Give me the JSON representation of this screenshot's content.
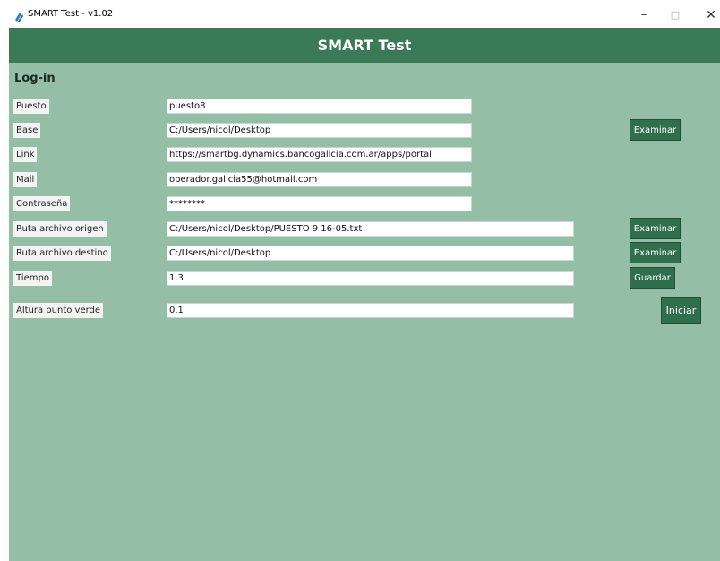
{
  "window": {
    "title": "SMART Test - v1.02",
    "minimize": "–",
    "maximize": "□",
    "close": "✕"
  },
  "header": {
    "title": "SMART Test"
  },
  "section_title": "Log-in",
  "fields": {
    "puesto": {
      "label": "Puesto",
      "value": "puesto8"
    },
    "base": {
      "label": "Base",
      "value": "C:/Users/nicol/Desktop"
    },
    "link": {
      "label": "Link",
      "value": "https://smartbg.dynamics.bancogalicia.com.ar/apps/portal"
    },
    "mail": {
      "label": "Mail",
      "value": "operador.galicia55@hotmail.com"
    },
    "password": {
      "label": "Contraseña",
      "value": "********"
    },
    "origen": {
      "label": "Ruta archivo origen",
      "value": "C:/Users/nicol/Desktop/PUESTO 9 16-05.txt"
    },
    "destino": {
      "label": "Ruta archivo destino",
      "value": "C:/Users/nicol/Desktop"
    },
    "tiempo": {
      "label": "Tiempo",
      "value": "1.3"
    },
    "altura": {
      "label": "Altura punto verde",
      "value": "0.1"
    }
  },
  "buttons": {
    "examinar": "Examinar",
    "guardar": "Guardar",
    "iniciar": "Iniciar"
  },
  "colors": {
    "header": "#3b7a57",
    "background": "#94bea5",
    "button": "#2f6f4b"
  }
}
